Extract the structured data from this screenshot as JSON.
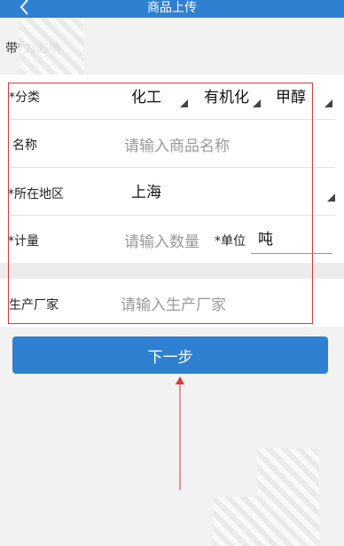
{
  "header": {
    "title": "商品上传"
  },
  "hint": {
    "text": "带*为必填"
  },
  "form": {
    "category": {
      "label": "*分类",
      "levels": [
        "化工",
        "有机化",
        "甲醇"
      ]
    },
    "name": {
      "label": "名称",
      "placeholder": "请输入商品名称"
    },
    "region": {
      "label": "*所在地区",
      "value": "上海"
    },
    "quantity": {
      "label": "*计量",
      "placeholder": "请输入数量",
      "unit_label": "*单位",
      "unit_value": "吨"
    },
    "manufacturer": {
      "label": "生产厂家",
      "placeholder": "请输入生产厂家"
    }
  },
  "next_button": {
    "label": "下一步"
  },
  "colors": {
    "primary": "#2f80d1",
    "annotation": "#d33c3c"
  }
}
